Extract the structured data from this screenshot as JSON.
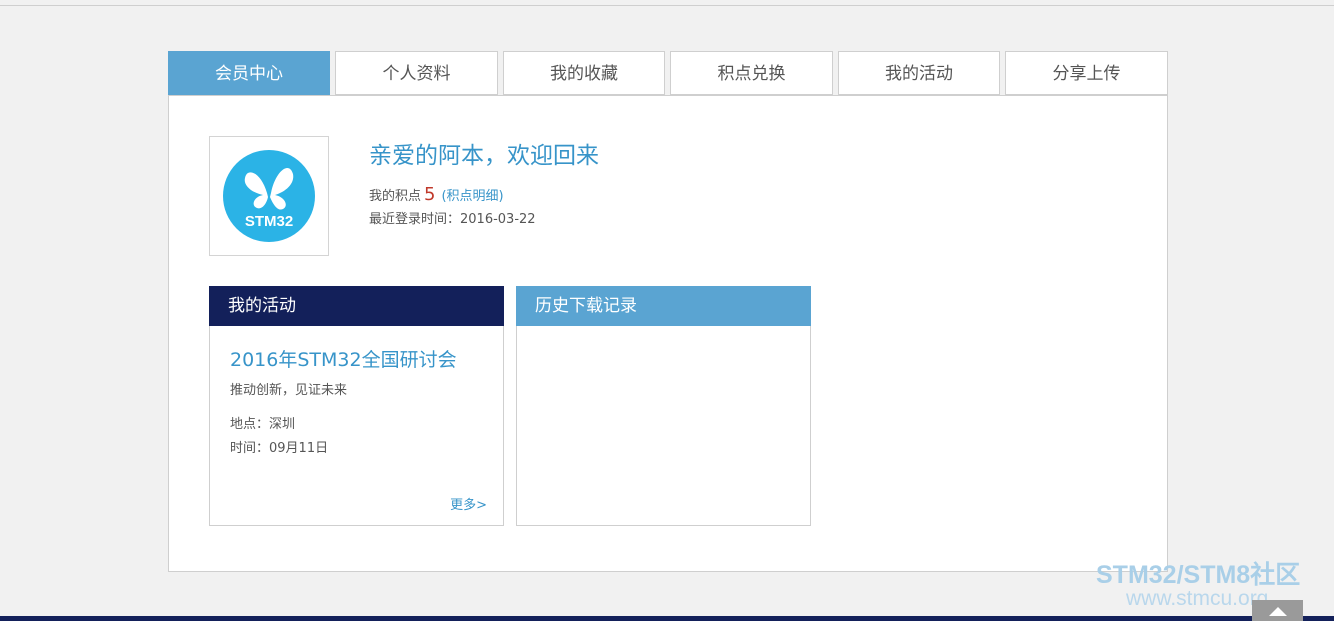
{
  "tabs": [
    {
      "label": "会员中心",
      "active": true
    },
    {
      "label": "个人资料",
      "active": false
    },
    {
      "label": "我的收藏",
      "active": false
    },
    {
      "label": "积点兑换",
      "active": false
    },
    {
      "label": "我的活动",
      "active": false
    },
    {
      "label": "分享上传",
      "active": false
    }
  ],
  "profile": {
    "avatar_icon": "stm32-butterfly-logo",
    "avatar_logo_text": "STM32",
    "welcome": "亲爱的阿本，欢迎回来",
    "points_label": "我的积点",
    "points_value": "5",
    "points_link": "(积点明细)",
    "last_login": "最近登录时间：2016-03-22"
  },
  "activity_card": {
    "header": "我的活动",
    "event_title": "2016年STM32全国研讨会",
    "event_slogan": "推动创新，见证未来",
    "event_place": "地点：深圳",
    "event_time": "时间：09月11日",
    "more": "更多>"
  },
  "history_card": {
    "header": "历史下载记录"
  },
  "watermark": {
    "line1": "STM32/STM8社区",
    "line2": "www.stmcu.org"
  },
  "back_to_top_icon": "arrow-up-icon",
  "colors": {
    "accent": "#5aa4d2",
    "navy": "#13205a",
    "link": "#3794c9",
    "points": "#c0392b"
  }
}
